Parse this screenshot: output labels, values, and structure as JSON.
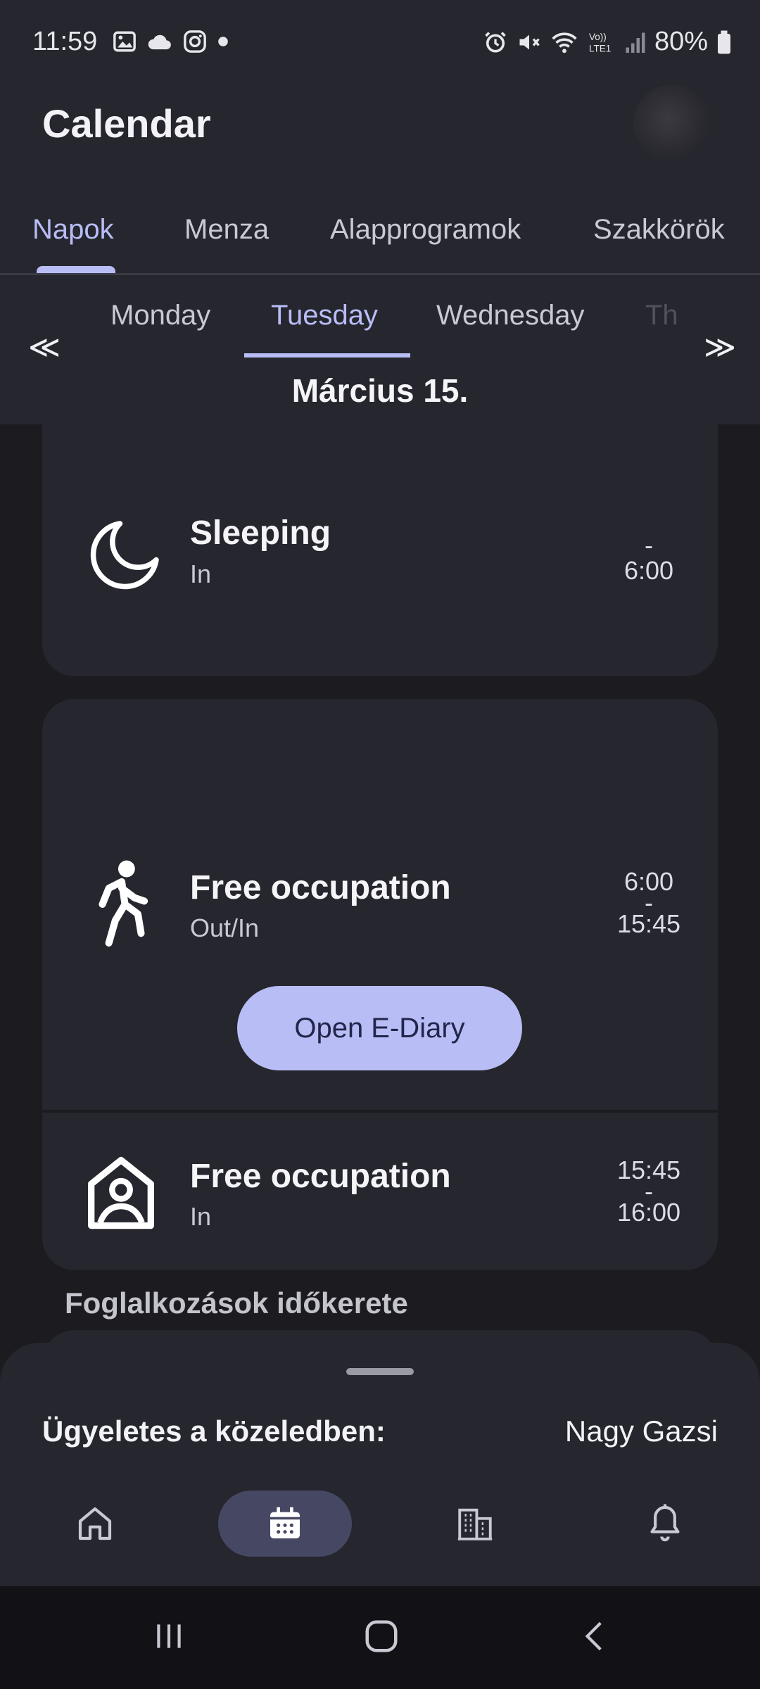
{
  "status_bar": {
    "time": "11:59",
    "battery": "80%",
    "left_icons": [
      "gallery-icon",
      "cloud-icon",
      "instagram-icon",
      "dot-icon"
    ],
    "right_icons": [
      "alarm-icon",
      "mute-icon",
      "wifi-icon",
      "volte-icon",
      "signal-icon",
      "battery-icon"
    ]
  },
  "header": {
    "title": "Calendar"
  },
  "main_tabs": [
    {
      "label": "Napok",
      "active": true
    },
    {
      "label": "Menza",
      "active": false
    },
    {
      "label": "Alapprogramok",
      "active": false
    },
    {
      "label": "Szakkörök",
      "active": false
    }
  ],
  "day_selector": {
    "days": [
      {
        "label": "Monday",
        "active": false
      },
      {
        "label": "Tuesday",
        "active": true
      },
      {
        "label": "Wednesday",
        "active": false
      },
      {
        "label": "Th",
        "active": false
      }
    ],
    "prev_arrow": "≪",
    "next_arrow": "≫",
    "date": "Március 15."
  },
  "activities": [
    {
      "icon": "moon-icon",
      "title": "Sleeping",
      "subtitle": "In",
      "time_start": "",
      "time_sep": "-",
      "time_end": "6:00"
    },
    {
      "icon": "walking-person-icon",
      "title": "Free occupation",
      "subtitle": "Out/In",
      "time_start": "6:00",
      "time_sep": "-",
      "time_end": "15:45"
    },
    {
      "icon": "home-person-icon",
      "title": "Free occupation",
      "subtitle": "In",
      "time_start": "15:45",
      "time_sep": "-",
      "time_end": "16:00"
    }
  ],
  "ediary_button": "Open E-Diary",
  "section_title": "Foglalkozások időkerete",
  "bottom_sheet": {
    "on_duty_label": "Ügyeletes a közeledben:",
    "on_duty_name": "Nagy Gazsi"
  },
  "bottom_nav": [
    {
      "icon": "home-icon",
      "active": false
    },
    {
      "icon": "calendar-icon",
      "active": true
    },
    {
      "icon": "building-icon",
      "active": false
    },
    {
      "icon": "bell-icon",
      "active": false
    }
  ],
  "system_nav": [
    "recents-button",
    "home-button",
    "back-button"
  ],
  "colors": {
    "background": "#1b1b20",
    "surface": "#25262e",
    "accent": "#b9bdf5",
    "nav_active": "#464863"
  }
}
